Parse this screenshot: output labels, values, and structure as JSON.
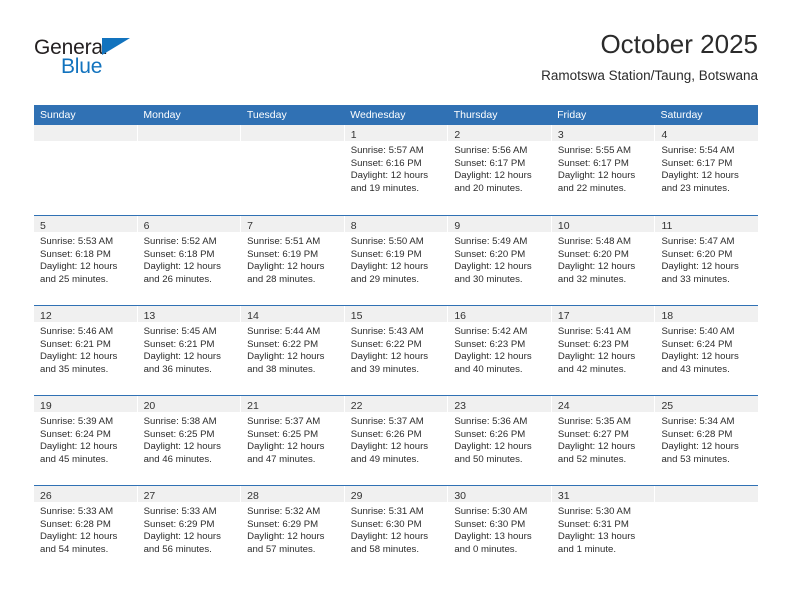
{
  "brand": {
    "name_top": "General",
    "name_bottom": "Blue",
    "accent_color": "#1273be",
    "triangle_icon": "triangle-icon"
  },
  "header": {
    "title": "October 2025",
    "subtitle": "Ramotswa Station/Taung, Botswana"
  },
  "theme": {
    "header_blue": "#3071b4",
    "day_band_gray": "#f0f0f0",
    "text": "#2c2c2c"
  },
  "calendar": {
    "weekdays": [
      "Sunday",
      "Monday",
      "Tuesday",
      "Wednesday",
      "Thursday",
      "Friday",
      "Saturday"
    ],
    "weeks": [
      [
        {
          "day": "",
          "lines": []
        },
        {
          "day": "",
          "lines": []
        },
        {
          "day": "",
          "lines": []
        },
        {
          "day": "1",
          "lines": [
            "Sunrise: 5:57 AM",
            "Sunset: 6:16 PM",
            "Daylight: 12 hours",
            "and 19 minutes."
          ]
        },
        {
          "day": "2",
          "lines": [
            "Sunrise: 5:56 AM",
            "Sunset: 6:17 PM",
            "Daylight: 12 hours",
            "and 20 minutes."
          ]
        },
        {
          "day": "3",
          "lines": [
            "Sunrise: 5:55 AM",
            "Sunset: 6:17 PM",
            "Daylight: 12 hours",
            "and 22 minutes."
          ]
        },
        {
          "day": "4",
          "lines": [
            "Sunrise: 5:54 AM",
            "Sunset: 6:17 PM",
            "Daylight: 12 hours",
            "and 23 minutes."
          ]
        }
      ],
      [
        {
          "day": "5",
          "lines": [
            "Sunrise: 5:53 AM",
            "Sunset: 6:18 PM",
            "Daylight: 12 hours",
            "and 25 minutes."
          ]
        },
        {
          "day": "6",
          "lines": [
            "Sunrise: 5:52 AM",
            "Sunset: 6:18 PM",
            "Daylight: 12 hours",
            "and 26 minutes."
          ]
        },
        {
          "day": "7",
          "lines": [
            "Sunrise: 5:51 AM",
            "Sunset: 6:19 PM",
            "Daylight: 12 hours",
            "and 28 minutes."
          ]
        },
        {
          "day": "8",
          "lines": [
            "Sunrise: 5:50 AM",
            "Sunset: 6:19 PM",
            "Daylight: 12 hours",
            "and 29 minutes."
          ]
        },
        {
          "day": "9",
          "lines": [
            "Sunrise: 5:49 AM",
            "Sunset: 6:20 PM",
            "Daylight: 12 hours",
            "and 30 minutes."
          ]
        },
        {
          "day": "10",
          "lines": [
            "Sunrise: 5:48 AM",
            "Sunset: 6:20 PM",
            "Daylight: 12 hours",
            "and 32 minutes."
          ]
        },
        {
          "day": "11",
          "lines": [
            "Sunrise: 5:47 AM",
            "Sunset: 6:20 PM",
            "Daylight: 12 hours",
            "and 33 minutes."
          ]
        }
      ],
      [
        {
          "day": "12",
          "lines": [
            "Sunrise: 5:46 AM",
            "Sunset: 6:21 PM",
            "Daylight: 12 hours",
            "and 35 minutes."
          ]
        },
        {
          "day": "13",
          "lines": [
            "Sunrise: 5:45 AM",
            "Sunset: 6:21 PM",
            "Daylight: 12 hours",
            "and 36 minutes."
          ]
        },
        {
          "day": "14",
          "lines": [
            "Sunrise: 5:44 AM",
            "Sunset: 6:22 PM",
            "Daylight: 12 hours",
            "and 38 minutes."
          ]
        },
        {
          "day": "15",
          "lines": [
            "Sunrise: 5:43 AM",
            "Sunset: 6:22 PM",
            "Daylight: 12 hours",
            "and 39 minutes."
          ]
        },
        {
          "day": "16",
          "lines": [
            "Sunrise: 5:42 AM",
            "Sunset: 6:23 PM",
            "Daylight: 12 hours",
            "and 40 minutes."
          ]
        },
        {
          "day": "17",
          "lines": [
            "Sunrise: 5:41 AM",
            "Sunset: 6:23 PM",
            "Daylight: 12 hours",
            "and 42 minutes."
          ]
        },
        {
          "day": "18",
          "lines": [
            "Sunrise: 5:40 AM",
            "Sunset: 6:24 PM",
            "Daylight: 12 hours",
            "and 43 minutes."
          ]
        }
      ],
      [
        {
          "day": "19",
          "lines": [
            "Sunrise: 5:39 AM",
            "Sunset: 6:24 PM",
            "Daylight: 12 hours",
            "and 45 minutes."
          ]
        },
        {
          "day": "20",
          "lines": [
            "Sunrise: 5:38 AM",
            "Sunset: 6:25 PM",
            "Daylight: 12 hours",
            "and 46 minutes."
          ]
        },
        {
          "day": "21",
          "lines": [
            "Sunrise: 5:37 AM",
            "Sunset: 6:25 PM",
            "Daylight: 12 hours",
            "and 47 minutes."
          ]
        },
        {
          "day": "22",
          "lines": [
            "Sunrise: 5:37 AM",
            "Sunset: 6:26 PM",
            "Daylight: 12 hours",
            "and 49 minutes."
          ]
        },
        {
          "day": "23",
          "lines": [
            "Sunrise: 5:36 AM",
            "Sunset: 6:26 PM",
            "Daylight: 12 hours",
            "and 50 minutes."
          ]
        },
        {
          "day": "24",
          "lines": [
            "Sunrise: 5:35 AM",
            "Sunset: 6:27 PM",
            "Daylight: 12 hours",
            "and 52 minutes."
          ]
        },
        {
          "day": "25",
          "lines": [
            "Sunrise: 5:34 AM",
            "Sunset: 6:28 PM",
            "Daylight: 12 hours",
            "and 53 minutes."
          ]
        }
      ],
      [
        {
          "day": "26",
          "lines": [
            "Sunrise: 5:33 AM",
            "Sunset: 6:28 PM",
            "Daylight: 12 hours",
            "and 54 minutes."
          ]
        },
        {
          "day": "27",
          "lines": [
            "Sunrise: 5:33 AM",
            "Sunset: 6:29 PM",
            "Daylight: 12 hours",
            "and 56 minutes."
          ]
        },
        {
          "day": "28",
          "lines": [
            "Sunrise: 5:32 AM",
            "Sunset: 6:29 PM",
            "Daylight: 12 hours",
            "and 57 minutes."
          ]
        },
        {
          "day": "29",
          "lines": [
            "Sunrise: 5:31 AM",
            "Sunset: 6:30 PM",
            "Daylight: 12 hours",
            "and 58 minutes."
          ]
        },
        {
          "day": "30",
          "lines": [
            "Sunrise: 5:30 AM",
            "Sunset: 6:30 PM",
            "Daylight: 13 hours",
            "and 0 minutes."
          ]
        },
        {
          "day": "31",
          "lines": [
            "Sunrise: 5:30 AM",
            "Sunset: 6:31 PM",
            "Daylight: 13 hours",
            "and 1 minute."
          ]
        },
        {
          "day": "",
          "lines": []
        }
      ]
    ]
  }
}
